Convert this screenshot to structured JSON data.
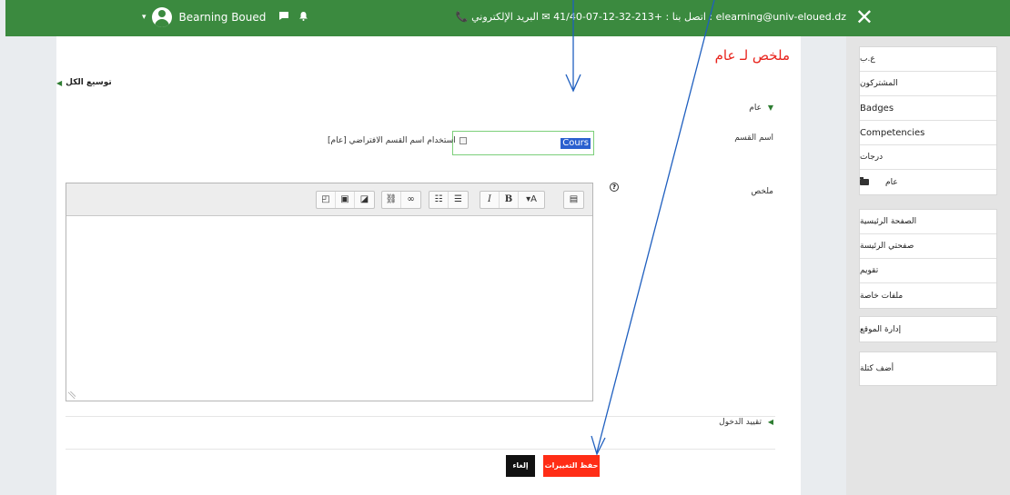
{
  "topbar": {
    "close_symbol": "✕",
    "contact_text": "📞 اتصل بنا : +213-32-12-07-41/40 ✉ البريد الإلكتروني : elearning@univ-eloued.dz",
    "user_name": "Bearning Boued",
    "caret": "▾",
    "message_icon": "chat-icon",
    "notification_icon": "bell-icon"
  },
  "main": {
    "page_title": "ملخص لـ عام",
    "expand_all": "توسيع الكل",
    "section_general": "عام",
    "name_label": "اسم القسم",
    "name_value": "Cours",
    "default_name_checkbox": "استخدام اسم القسم الافتراضي [عام]",
    "summary_label": "ملخص",
    "restrict_access": "تقييد الدخول",
    "save_button": "حفظ التغييرات",
    "cancel_button": "إلغاء"
  },
  "toolbar": {
    "buttons": [
      "▤",
      "▾A",
      "B",
      "I",
      "☰",
      "☷",
      "🔗",
      "⛓",
      "▣",
      "◧",
      "▯"
    ]
  },
  "sidebar": {
    "block1": [
      "ع.ب",
      "المشتركون",
      "Badges",
      "Competencies",
      "درجات",
      "عام"
    ],
    "block2": [
      "الصفحة الرئيسية",
      "صفحتي الرئيسة",
      "تقويم",
      "ملفات خاصة"
    ],
    "block3": "إدارة الموقع",
    "block4": "أضف كتلة"
  },
  "colors": {
    "topbar": "#3b8a3f",
    "title": "#e8221b",
    "save": "#ff2d16",
    "cancel": "#111111",
    "arrow": "#1f5fbf"
  }
}
